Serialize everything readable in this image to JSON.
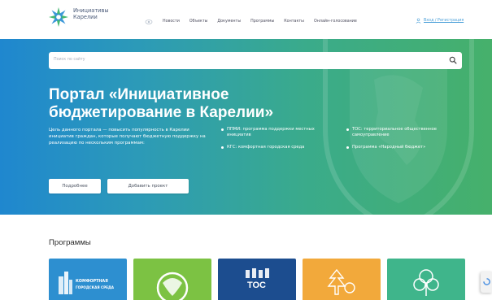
{
  "header": {
    "logo_text": "Инициативы Карелии",
    "nav": [
      "Новости",
      "Объекты",
      "Документы",
      "Программы",
      "Контакты",
      "Онлайн-голосование"
    ],
    "auth_label": "Вход / Регистрация"
  },
  "search": {
    "placeholder": "Поиск по сайту"
  },
  "hero": {
    "title": "Портал «Инициативное бюджетирование в Карелии»",
    "description": "Цель данного портала — повысить популярность в Карелии инициатив граждан, которые получают бюджетную поддержку на реализацию по нескольким программам:",
    "programs_list": [
      "ППМИ: программа поддержки местных инициатив",
      "ТОС: территориальное общественное самоуправление",
      "КГС: комфортная городская среда",
      "Программа «Народный бюджет»"
    ],
    "btn_more": "Подробнее",
    "btn_add": "Добавить проект"
  },
  "programs": {
    "title": "Программы",
    "cards": [
      {
        "name": "comfort-city",
        "color": "#2d8fd0",
        "label_line1": "КОМФОРТНАЯ",
        "label_line2": "ГОРОДСКАЯ СРЕДА"
      },
      {
        "name": "ppmi",
        "color": "#7cc243"
      },
      {
        "name": "tos",
        "color": "#1c4d8f",
        "label": "ТОС"
      },
      {
        "name": "people-budget",
        "color": "#f2a93b"
      },
      {
        "name": "local-initiative",
        "color": "#3fb58b"
      }
    ]
  },
  "colors": {
    "primary_blue": "#1f87cf",
    "primary_green": "#46b06b",
    "link": "#4a9fd8"
  }
}
